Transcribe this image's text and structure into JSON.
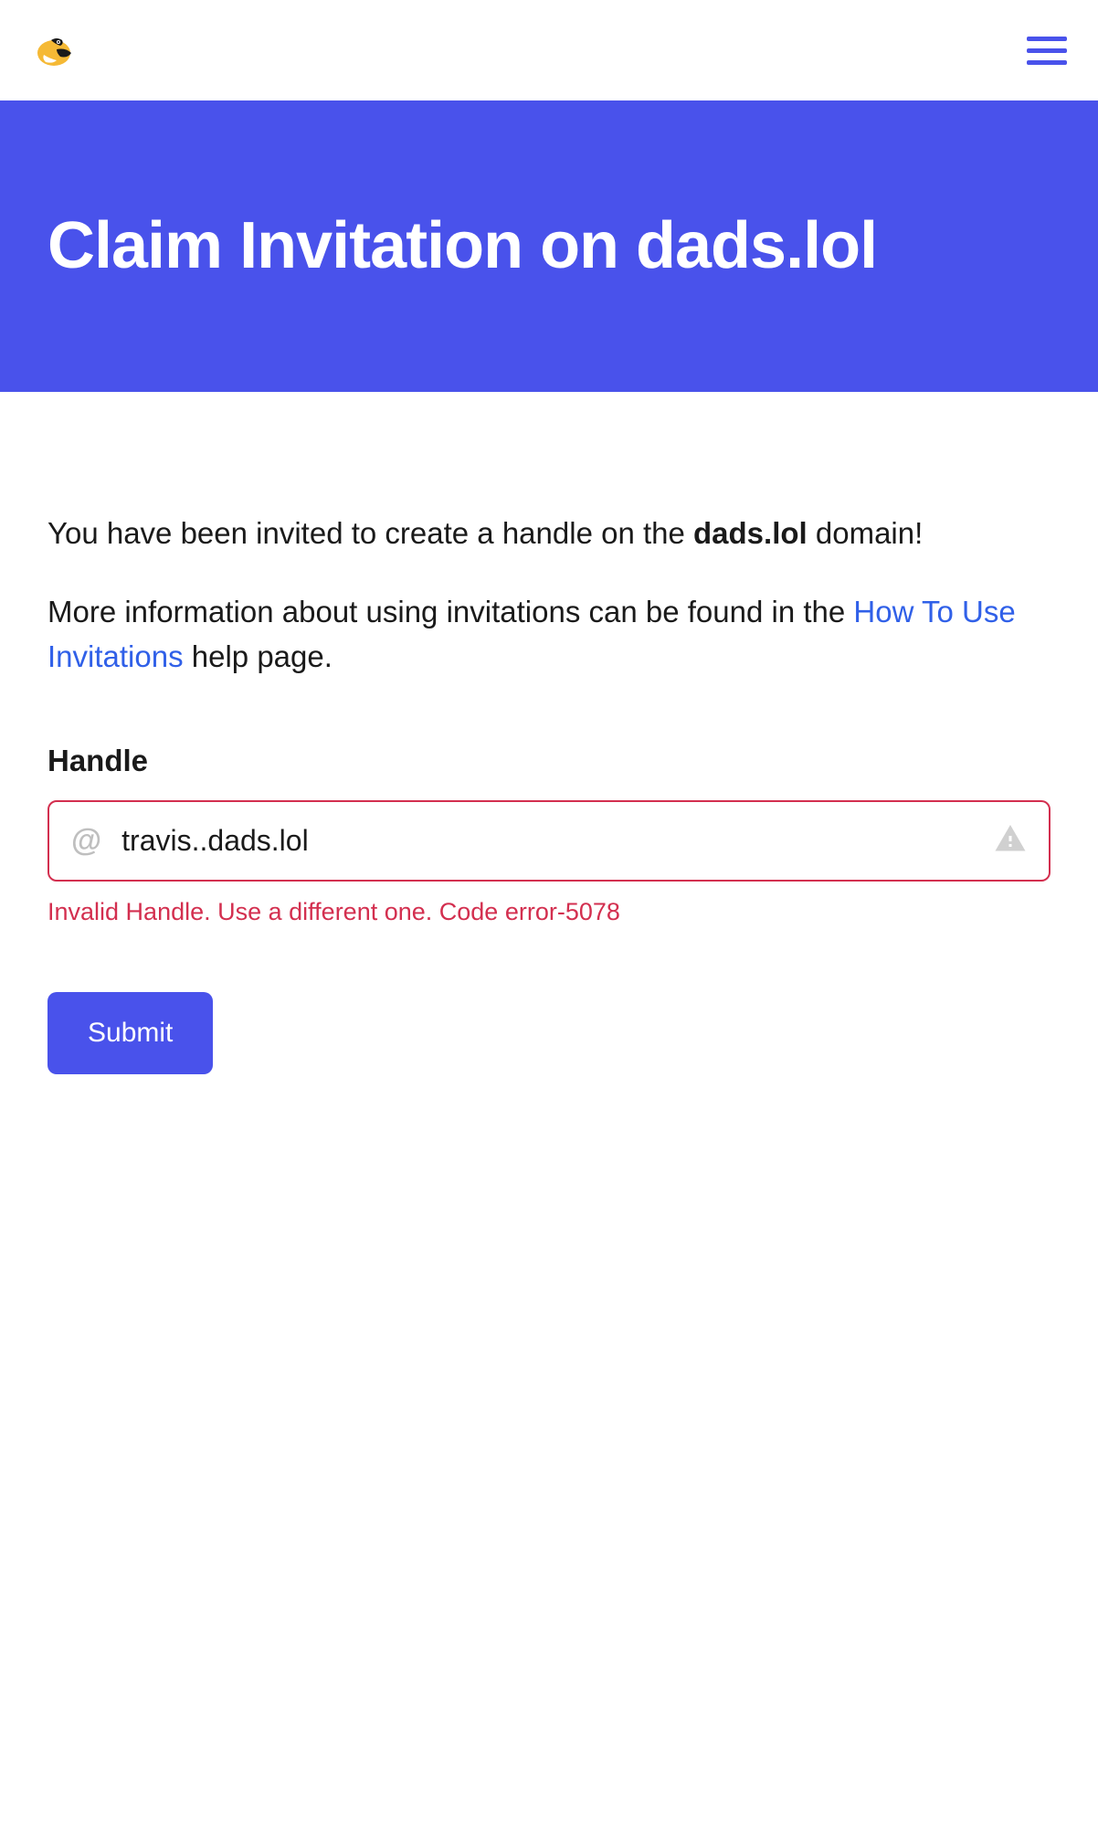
{
  "hero": {
    "title": "Claim Invitation on dads.lol"
  },
  "content": {
    "intro_prefix": "You have been invited to create a handle on the ",
    "intro_domain": "dads.lol",
    "intro_suffix": " domain!",
    "more_info_prefix": "More information about using invitations can be found in the ",
    "more_info_link": "How To Use Invitations",
    "more_info_suffix": " help page."
  },
  "form": {
    "handle_label": "Handle",
    "handle_value": "travis..dads.lol",
    "at_symbol": "@",
    "error_message": "Invalid Handle. Use a different one. Code error-5078",
    "submit_label": "Submit"
  }
}
